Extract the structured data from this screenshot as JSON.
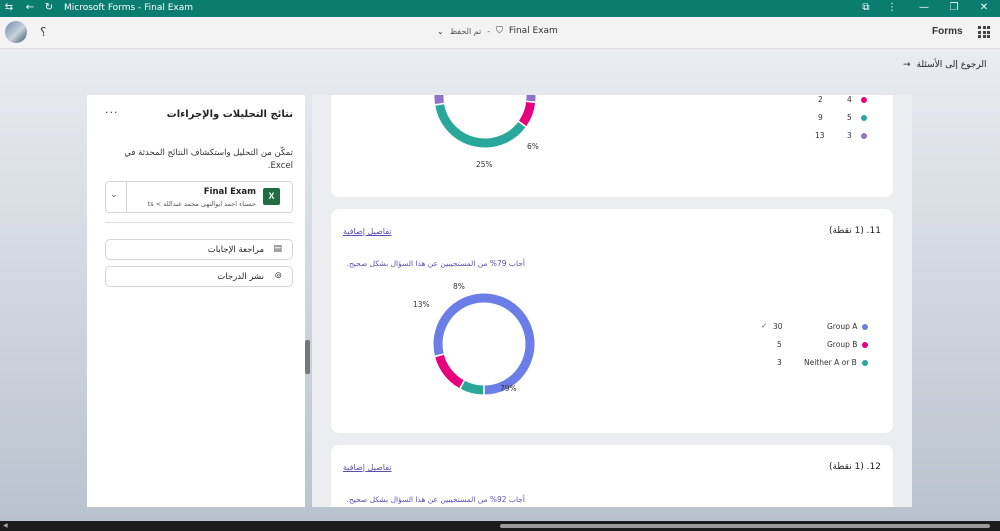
{
  "window": {
    "title": "Microsoft Forms - Final Exam"
  },
  "header": {
    "saved_status": "تم الحفظ",
    "separator": "-",
    "form_name": "Final Exam",
    "app_name": "Forms",
    "help_glyph": "؟"
  },
  "back_link": "الرجوع إلى الأسئلة",
  "panel": {
    "title": "نتائج التحليلات والإجراءات",
    "more": "···",
    "description": "تمكّن من التحليل واستكشاف النتائج المحدثة في Excel.",
    "excel": {
      "file_name": "Final Exam",
      "path": "حسناء احمد ابوالنهى محمد عبدالله > ts"
    },
    "actions": [
      {
        "label": "مراجعة الإجابات",
        "icon": "review-icon"
      },
      {
        "label": "نشر الدرجات",
        "icon": "publish-icon"
      }
    ]
  },
  "question10_partial": {
    "slice_labels": [
      "25%",
      "6%"
    ],
    "legend": [
      {
        "count": "2",
        "value": "4",
        "color": "#e6007e"
      },
      {
        "count": "9",
        "value": "5",
        "color": "#2aa79b"
      },
      {
        "count": "13",
        "value": "3",
        "color": "#8f73c6"
      }
    ]
  },
  "question11": {
    "title": "11. (1 نقطة)",
    "more_details": "تفاصيل إضافية",
    "correct_note": "أجاب 79% من المستجيبين عن هذا السؤال بشكل صحيح.",
    "legend": [
      {
        "label": "Group A",
        "count": "30",
        "color": "#6b7de6",
        "correct": "✓"
      },
      {
        "label": "Group B",
        "count": "5",
        "color": "#e6007e"
      },
      {
        "label": "Neither A or B",
        "count": "3",
        "color": "#2aa79b"
      }
    ],
    "chart_labels": [
      "79%",
      "13%",
      "8%"
    ]
  },
  "question12": {
    "title": "12. (1 نقطة)",
    "more_details": "تفاصيل إضافية",
    "correct_note": "أجاب 92% من المستجيبين عن هذا السؤال بشكل صحيح."
  },
  "chart_data": [
    {
      "type": "pie",
      "categories": [
        "4",
        "5",
        "3"
      ],
      "values": [
        2,
        9,
        13
      ],
      "colors": [
        "#e6007e",
        "#2aa79b",
        "#8f73c6"
      ],
      "title": ""
    },
    {
      "type": "pie",
      "categories": [
        "Group A",
        "Group B",
        "Neither A or B"
      ],
      "values": [
        30,
        5,
        3
      ],
      "colors": [
        "#6b7de6",
        "#e6007e",
        "#2aa79b"
      ],
      "title": ""
    }
  ]
}
